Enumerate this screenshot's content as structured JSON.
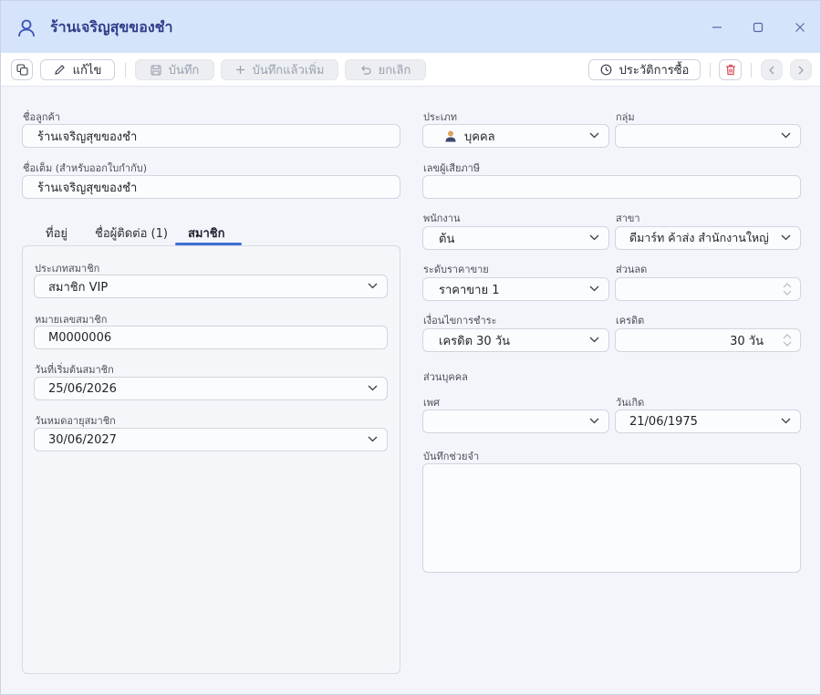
{
  "window": {
    "title": "ร้านเจริญสุขของชำ",
    "minimize_icon": "minimize-icon",
    "maximize_icon": "maximize-icon",
    "close_icon": "close-icon"
  },
  "toolbar": {
    "edit_label": "แก้ไข",
    "save_label": "บันทึก",
    "save_and_add_label": "บันทึกแล้วเพิ่ม",
    "cancel_label": "ยกเลิก",
    "purchase_history_label": "ประวัติการซื้อ"
  },
  "left": {
    "customer_name_label": "ชื่อลูกค้า",
    "customer_name_value": "ร้านเจริญสุขของชำ",
    "full_name_label": "ชื่อเต็ม (สำหรับออกใบกำกับ)",
    "full_name_value": "ร้านเจริญสุขของชำ",
    "tabs": [
      {
        "label": "ที่อยู่"
      },
      {
        "label": "ชื่อผู้ติดต่อ (1)"
      },
      {
        "label": "สมาชิก"
      }
    ],
    "member": {
      "type_label": "ประเภทสมาชิก",
      "type_value": "สมาชิก VIP",
      "number_label": "หมายเลขสมาชิก",
      "number_value": "M0000006",
      "start_label": "วันที่เริ่มต้นสมาชิก",
      "start_value": "25/06/2026",
      "expire_label": "วันหมดอายุสมาชิก",
      "expire_value": "30/06/2027"
    }
  },
  "right": {
    "type_label": "ประเภท",
    "type_value": "บุคคล",
    "group_label": "กลุ่ม",
    "group_value": "",
    "tax_id_label": "เลขผู้เสียภาษี",
    "tax_id_value": "",
    "employee_label": "พนักงาน",
    "employee_value": "ต้น",
    "branch_label": "สาขา",
    "branch_value": "ดีมาร์ท ค้าส่ง สำนักงานใหญ่",
    "price_level_label": "ระดับราคาขาย",
    "price_level_value": "ราคาขาย 1",
    "discount_label": "ส่วนลด",
    "discount_value": "",
    "payment_terms_label": "เงื่อนไขการชำระ",
    "payment_terms_value": "เครดิต 30 วัน",
    "credit_label": "เครดิต",
    "credit_value": "30 วัน",
    "personal_section_label": "ส่วนบุคคล",
    "gender_label": "เพศ",
    "gender_value": "",
    "birthdate_label": "วันเกิด",
    "birthdate_value": "21/06/1975",
    "memo_label": "บันทึกช่วยจำ",
    "memo_value": ""
  },
  "colors": {
    "titlebar_bg": "#d6e4fb",
    "title_text": "#2f3e8a",
    "accent": "#3d6fd6",
    "delete_red": "#d64a5b"
  }
}
